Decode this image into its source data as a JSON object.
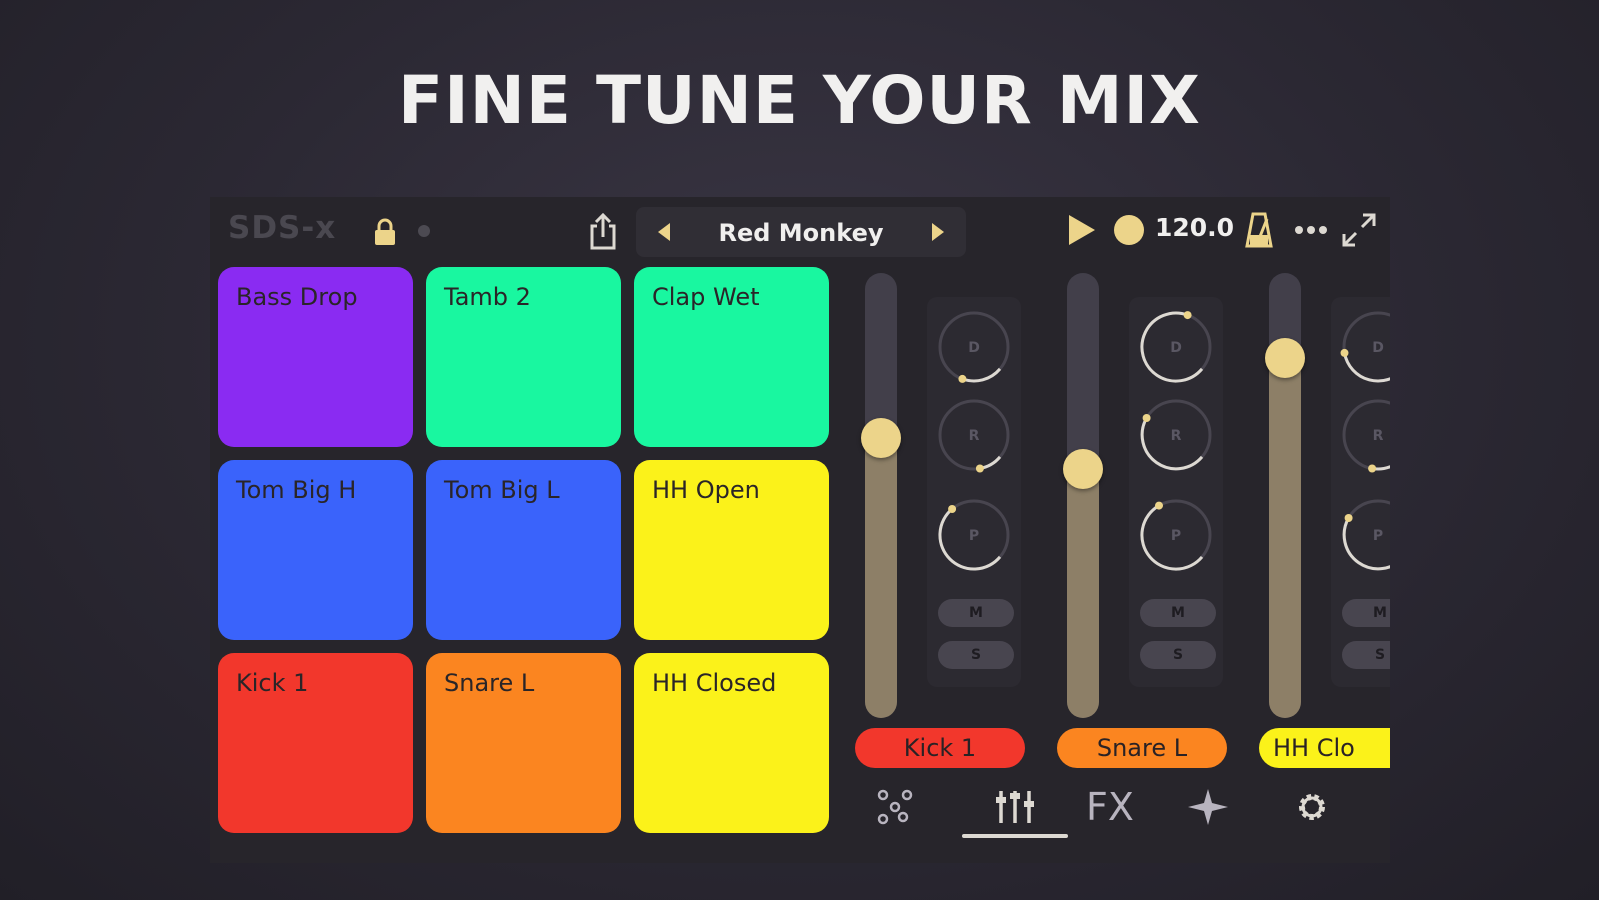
{
  "headline": "FINE TUNE YOUR MIX",
  "app": {
    "logo": "SDS-x",
    "kit_name": "Red Monkey",
    "bpm": "120.0"
  },
  "pads": [
    {
      "label": "Bass Drop",
      "color": "#8a2bf2"
    },
    {
      "label": "Tamb 2",
      "color": "#19f7a0"
    },
    {
      "label": "Clap Wet",
      "color": "#19f7a0"
    },
    {
      "label": "Tom Big H",
      "color": "#3a63fb"
    },
    {
      "label": "Tom Big L",
      "color": "#3a63fb"
    },
    {
      "label": "HH Open",
      "color": "#fbf21a"
    },
    {
      "label": "Kick 1",
      "color": "#f2372c"
    },
    {
      "label": "Snare L",
      "color": "#fb8520"
    },
    {
      "label": "HH Closed",
      "color": "#fbf21a"
    }
  ],
  "mixer": {
    "channels": [
      {
        "label": "Kick 1",
        "color": "#f2372c",
        "volume": 0.63
      },
      {
        "label": "Snare L",
        "color": "#fb8520",
        "volume": 0.56
      },
      {
        "label": "HH Clo",
        "color": "#fbf21a",
        "volume": 0.81
      }
    ],
    "knob_labels": [
      "D",
      "R",
      "P"
    ],
    "mute_label": "M",
    "solo_label": "S"
  },
  "tabs": {
    "pads_icon": "pads-dots-icon",
    "mixer_icon": "mixer-sliders-icon",
    "fx_label": "FX",
    "sequencer_icon": "sparkle-icon",
    "settings_icon": "gear-icon",
    "active": "mixer"
  },
  "colors": {
    "accent": "#ecd48a",
    "background": "#27252b"
  }
}
